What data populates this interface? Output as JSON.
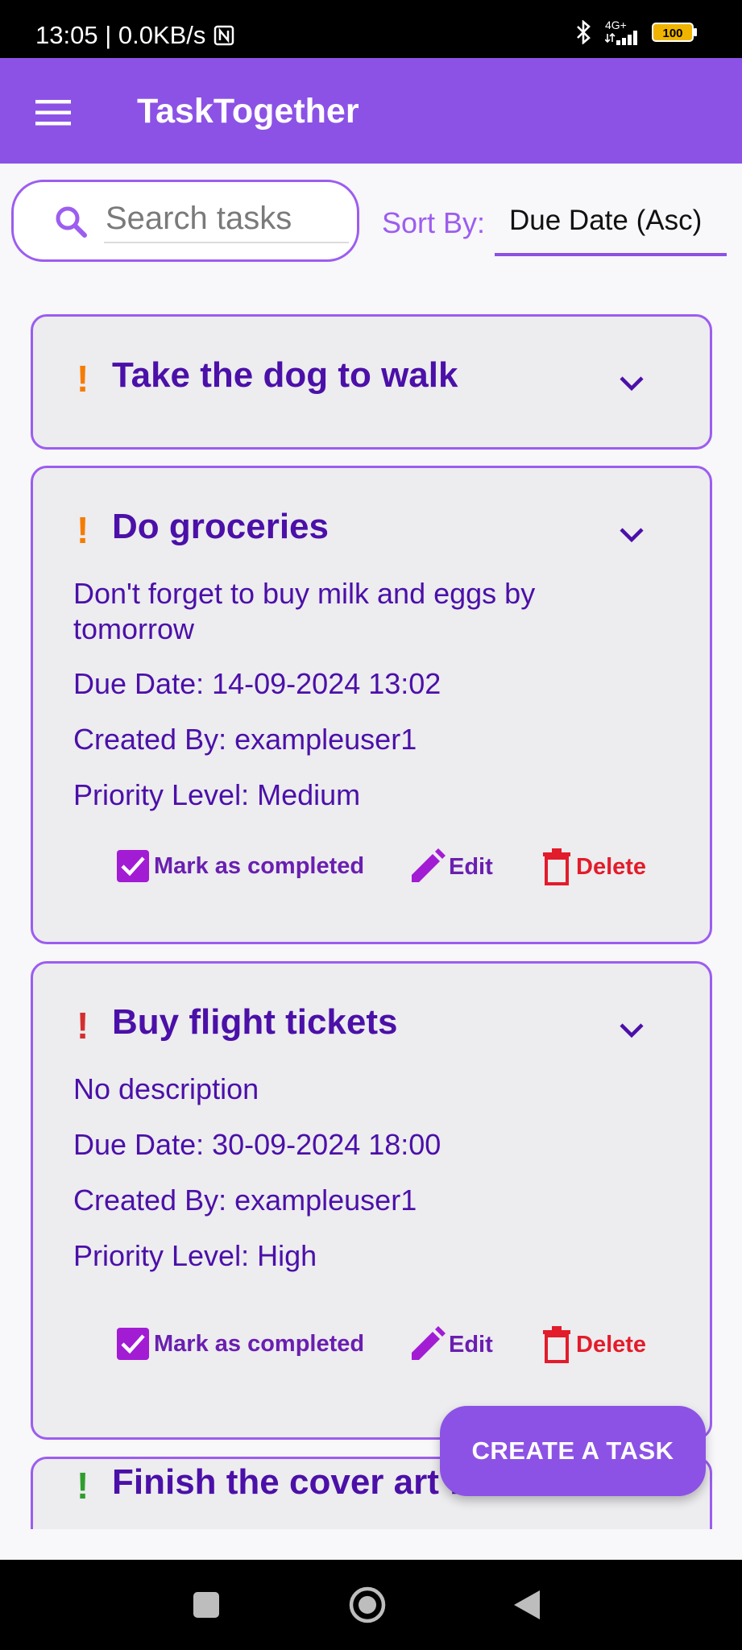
{
  "status": {
    "time_speed": "13:05 | 0.0KB/s",
    "network": "4G+",
    "battery": "100"
  },
  "app": {
    "title": "TaskTogether"
  },
  "search": {
    "placeholder": "Search tasks"
  },
  "sort": {
    "label": "Sort By:",
    "value": "Due Date (Asc)"
  },
  "tasks": [
    {
      "title": "Take the dog to walk",
      "priority_mark": "!",
      "priority_color": "#f57c00",
      "expanded": false
    },
    {
      "title": "Do groceries",
      "priority_mark": "!",
      "priority_color": "#f57c00",
      "expanded": true,
      "description": "Don't forget to buy milk and eggs by tomorrow",
      "due": "Due Date: 14-09-2024 13:02",
      "created_by": "Created By: exampleuser1",
      "priority_level": "Priority Level: Medium"
    },
    {
      "title": "Buy flight tickets",
      "priority_mark": "!",
      "priority_color": "#d32f2f",
      "expanded": true,
      "description": "No description",
      "due": "Due Date: 30-09-2024 18:00",
      "created_by": "Created By: exampleuser1",
      "priority_level": "Priority Level: High"
    },
    {
      "title": "Finish the cover art for our",
      "priority_mark": "!",
      "priority_color": "#2e9e2e",
      "expanded": false
    }
  ],
  "actions": {
    "complete": "Mark as completed",
    "edit": "Edit",
    "delete": "Delete"
  },
  "fab": {
    "label": "CREATE A TASK"
  },
  "colors": {
    "accent": "#8c52e5",
    "title_text": "#4b10a8",
    "delete": "#e21c2a"
  }
}
